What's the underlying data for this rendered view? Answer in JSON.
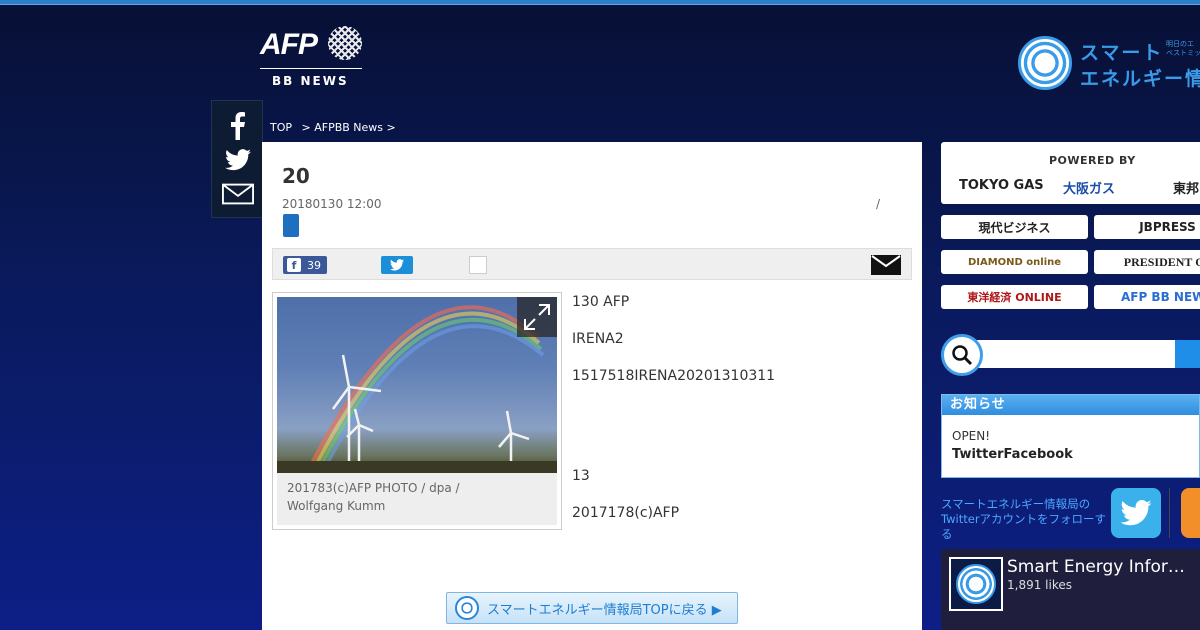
{
  "header": {
    "afp_logo_text": "AFP",
    "afp_sub": "BB NEWS",
    "se_logo_line1": "スマート",
    "se_logo_line2": "エネルギー情",
    "se_logo_tiny1": "明日のエ",
    "se_logo_tiny2": "ベストミッ"
  },
  "breadcrumb": {
    "top": "TOP",
    "section": "> AFPBB News >"
  },
  "article": {
    "title": "20",
    "date": "20180130 12:00",
    "slash": "/",
    "facebook_count": "39",
    "paragraphs": [
      "130 AFP",
      "IRENA2",
      "1517518IRENA20201310311",
      "13",
      "2017178(c)AFP"
    ],
    "caption_line1": "201783(c)AFP PHOTO / dpa /",
    "caption_line2": "Wolfgang Kumm",
    "back_button": "スマートエネルギー情報局TOPに戻る ▶"
  },
  "sidebar": {
    "powered_by": "POWERED BY",
    "sponsors_top": [
      "TOKYO GAS",
      "大阪ガス",
      "東邦"
    ],
    "sponsors": [
      "現代ビジネス",
      "JBPRESS",
      "DIAMOND online",
      "PRESIDENT On",
      "東洋経済 ONLINE",
      "AFP BB NEWS"
    ],
    "notice_title": "お知らせ",
    "notice_line1": "OPEN!",
    "notice_line2": "TwitterFacebook",
    "follow_text": "スマートエネルギー情報局の Twitterアカウントをフォローする",
    "fb_page_name": "Smart Energy Infor…",
    "fb_likes": "1,891 likes"
  },
  "colors": {
    "background_top": "#071034",
    "background_bottom": "#0d1f86",
    "accent": "#3a9be8",
    "facebook": "#3b5998",
    "twitter": "#1d8ed8"
  }
}
